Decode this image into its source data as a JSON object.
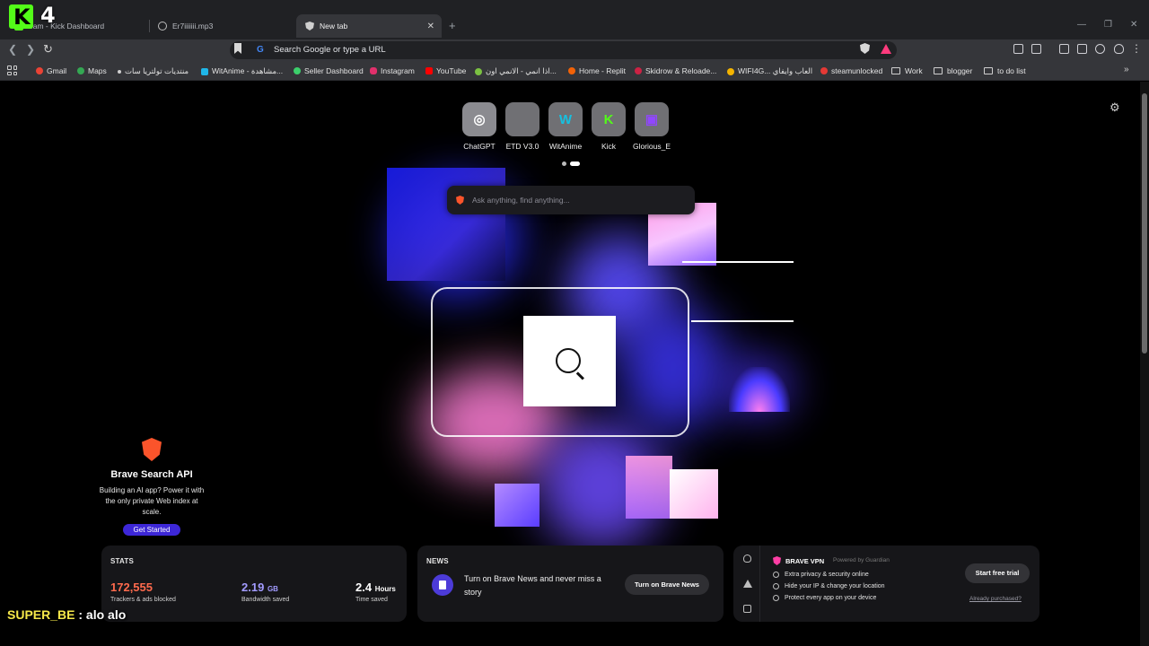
{
  "overlay": {
    "counter": "4",
    "chat_user": "SUPER_BE",
    "chat_text": " : alo alo"
  },
  "tabs": [
    {
      "title": "eam - Kick Dashboard"
    },
    {
      "title": "Er7iiiiiii.mp3"
    },
    {
      "title": "New tab",
      "active": true
    }
  ],
  "toolbar": {
    "omnibox_placeholder": "Search Google or type a URL"
  },
  "bookmarks": [
    {
      "label": "Gmail",
      "color": "#ea4335"
    },
    {
      "label": "Maps",
      "color": "#34a853"
    },
    {
      "label": "منتديات تولتريا سات",
      "color": "#d0d0d0"
    },
    {
      "label": "WitAnime - مشاهدة...",
      "color": "#1fb6e8"
    },
    {
      "label": "Seller Dashboard",
      "color": "#3ccf6b"
    },
    {
      "label": "Instagram",
      "color": "#e1306c"
    },
    {
      "label": "YouTube",
      "color": "#ff0000"
    },
    {
      "label": "اذا انمي - الانمي اون...",
      "color": "#7bc142"
    },
    {
      "label": "Home - Replit",
      "color": "#f26207"
    },
    {
      "label": "Skidrow & Reloade...",
      "color": "#cc2244"
    },
    {
      "label": "WIFI4G... العاب وايفاي",
      "color": "#f4b400"
    },
    {
      "label": "steamunlocked",
      "color": "#e53935"
    },
    {
      "label": "Work",
      "folder": true
    },
    {
      "label": "blogger",
      "folder": true
    },
    {
      "label": "to do list",
      "folder": true
    }
  ],
  "top_sites": [
    {
      "label": "ChatGPT",
      "glyph": "◎",
      "bg": "#8b8b90",
      "fg": "#ffffff"
    },
    {
      "label": "ETD V3.0",
      "glyph": "",
      "bg": "#707074",
      "fg": "#ffffff"
    },
    {
      "label": "WitAnime",
      "glyph": "W",
      "bg": "#707074",
      "fg": "#16c0e0"
    },
    {
      "label": "Kick",
      "glyph": "K",
      "bg": "#707074",
      "fg": "#53fc18"
    },
    {
      "label": "Glorious_E",
      "glyph": "▣",
      "bg": "#707074",
      "fg": "#9146ff"
    }
  ],
  "search": {
    "placeholder": "Ask anything, find anything..."
  },
  "promo": {
    "title": "Brave Search API",
    "desc": "Building an AI app? Power it with the only private Web index at scale.",
    "cta": "Get Started"
  },
  "stats": {
    "title": "STATS",
    "trackers": {
      "value": "172,555",
      "label": "Trackers & ads blocked",
      "color": "#ff6a4d"
    },
    "bandwidth": {
      "value": "2.19",
      "unit": "GB",
      "label": "Bandwidth saved",
      "color": "#a29bff"
    },
    "time": {
      "value": "2.4",
      "unit": "Hours",
      "label": "Time saved",
      "color": "#ffffff"
    }
  },
  "news": {
    "title": "NEWS",
    "text": "Turn on Brave News and never miss a story",
    "button": "Turn on Brave News"
  },
  "vpn": {
    "name": "BRAVE VPN",
    "powered": "Powered by Guardian",
    "features": [
      "Extra privacy & security online",
      "Hide your IP & change your location",
      "Protect every app on your device"
    ],
    "button": "Start free trial",
    "link": "Already purchased?"
  }
}
